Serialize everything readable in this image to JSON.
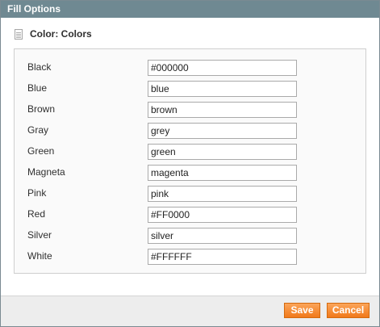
{
  "window": {
    "title": "Fill Options"
  },
  "section": {
    "title": "Color: Colors",
    "icon": "document-icon"
  },
  "colors": [
    {
      "label": "Black",
      "value": "#000000"
    },
    {
      "label": "Blue",
      "value": "blue"
    },
    {
      "label": "Brown",
      "value": "brown"
    },
    {
      "label": "Gray",
      "value": "grey"
    },
    {
      "label": "Green",
      "value": "green"
    },
    {
      "label": "Magneta",
      "value": "magenta"
    },
    {
      "label": "Pink",
      "value": "pink"
    },
    {
      "label": "Red",
      "value": "#FF0000"
    },
    {
      "label": "Silver",
      "value": "silver"
    },
    {
      "label": "White",
      "value": "#FFFFFF"
    }
  ],
  "buttons": {
    "save": "Save",
    "cancel": "Cancel"
  },
  "theme": {
    "titlebar": "#6f8992",
    "button_orange": "#f1791a"
  }
}
